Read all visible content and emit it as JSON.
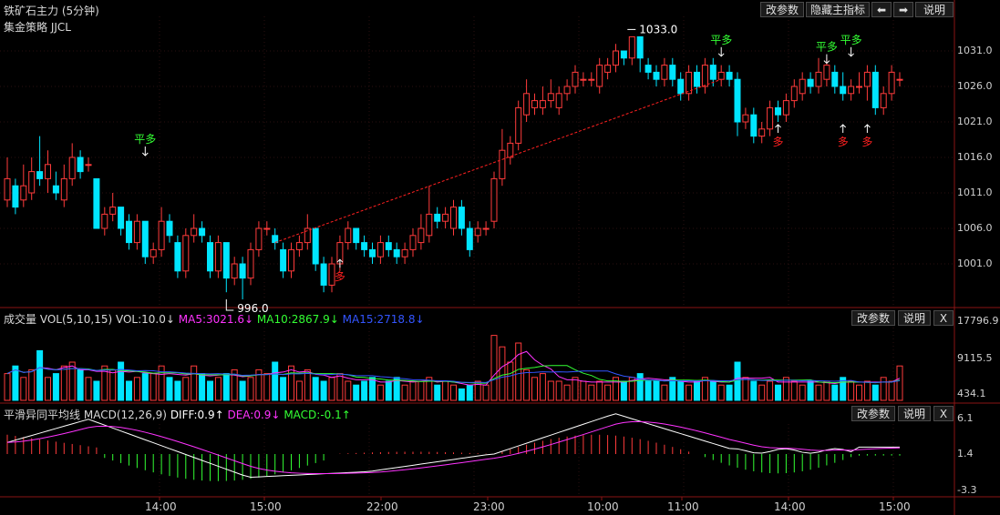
{
  "header": {
    "title": "铁矿石主力 (5分钟)",
    "strategy": "集金策略 JJCL",
    "buttons": {
      "params": "改参数",
      "hide_indicator": "隐藏主指标",
      "prev_icon": "arrow-left-icon",
      "next_icon": "arrow-right-icon",
      "help": "说明"
    }
  },
  "price_panel": {
    "y_ticks": [
      "1031.0",
      "1026.0",
      "1021.0",
      "1016.0",
      "1011.0",
      "1006.0",
      "1001.0"
    ],
    "high_label": "1033.0",
    "low_label": "996.0",
    "signals": {
      "flat_long": "平多",
      "long": "多"
    },
    "colors": {
      "up": "#ff3b3b",
      "down": "#00e5ff",
      "flat_signal": "#33ff33",
      "long_signal": "#ff2020"
    }
  },
  "volume_panel": {
    "label": "成交量",
    "params": "VOL(5,10,15)",
    "vol": "VOL:10.0↓",
    "ma5": "MA5:3021.6↓",
    "ma10": "MA10:2867.9↓",
    "ma15": "MA15:2718.8↓",
    "y_ticks": [
      "17796.9",
      "9115.5",
      "434.1"
    ],
    "buttons": {
      "params": "改参数",
      "help": "说明",
      "close": "X"
    },
    "colors": {
      "ma5": "#ff33ff",
      "ma10": "#33ff33",
      "ma15": "#3355ff"
    }
  },
  "macd_panel": {
    "label": "平滑异同平均线",
    "params": "MACD(12,26,9)",
    "diff": "DIFF:0.9↑",
    "dea": "DEA:0.9↓",
    "macd": "MACD:-0.1↑",
    "y_ticks": [
      "6.1",
      "1.4",
      "-3.3"
    ],
    "buttons": {
      "params": "改参数",
      "help": "说明",
      "close": "X"
    },
    "colors": {
      "diff": "#ffffff",
      "dea": "#ff33ff",
      "macd_pos": "#ff3b3b",
      "macd_neg": "#33ff33"
    }
  },
  "time_axis": [
    "14:00",
    "15:00",
    "22:00",
    "23:00",
    "10:00",
    "11:00",
    "14:00",
    "15:00"
  ]
}
